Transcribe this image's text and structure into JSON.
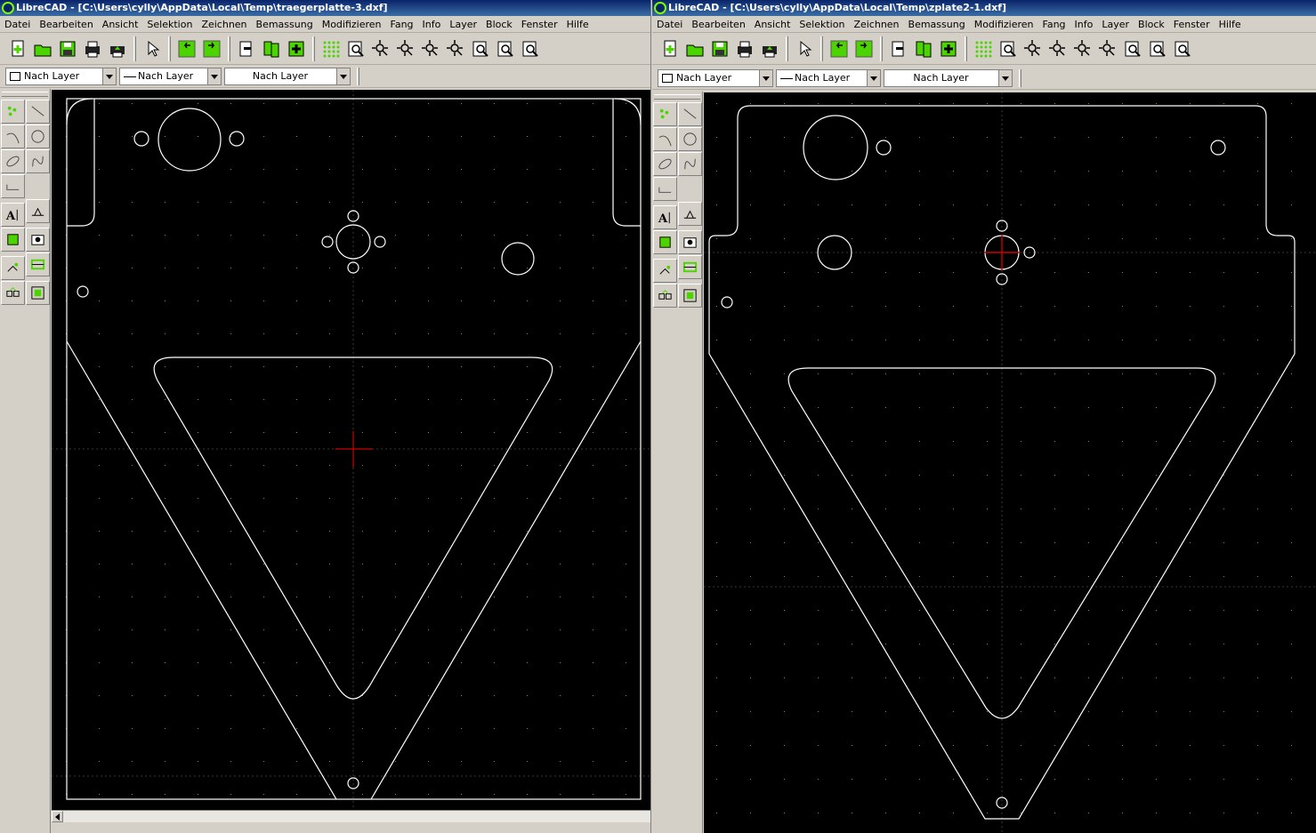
{
  "colors": {
    "title_bg": "#0a246a",
    "chrome": "#d4d0c8",
    "canvas_bg": "#000000",
    "drawing_line": "#ffffff",
    "crosshair": "#d00000",
    "grid_dot": "#808080",
    "icon_green": "#4cd400"
  },
  "windows": [
    {
      "title": "LibreCAD - [C:\\Users\\cylly\\AppData\\Local\\Temp\\traegerplatte-3.dxf]",
      "menu": [
        "Datei",
        "Bearbeiten",
        "Ansicht",
        "Selektion",
        "Zeichnen",
        "Bemassung",
        "Modifizieren",
        "Fang",
        "Info",
        "Layer",
        "Block",
        "Fenster",
        "Hilfe"
      ],
      "combos": {
        "color": "Nach Layer",
        "linetype": "Nach Layer",
        "width": "Nach Layer"
      }
    },
    {
      "title": "LibreCAD - [C:\\Users\\cylly\\AppData\\Local\\Temp\\zplate2-1.dxf]",
      "menu": [
        "Datei",
        "Bearbeiten",
        "Ansicht",
        "Selektion",
        "Zeichnen",
        "Bemassung",
        "Modifizieren",
        "Fang",
        "Info",
        "Layer",
        "Block",
        "Fenster",
        "Hilfe"
      ],
      "combos": {
        "color": "Nach Layer",
        "linetype": "Nach Layer",
        "width": "Nach Layer"
      }
    }
  ],
  "toolbar_icons": [
    "new-file-icon",
    "open-folder-icon",
    "save-icon",
    "print-icon",
    "print-preview-icon",
    "pointer-icon",
    "undo-icon",
    "redo-icon",
    "cut-icon",
    "copy-icon",
    "paste-icon",
    "grid-icon",
    "zoom-window-icon",
    "zoom-pan-icon",
    "zoom-in-icon",
    "zoom-out-icon",
    "zoom-auto-icon",
    "zoom-previous-icon",
    "zoom-redraw-icon",
    "zoom-select-icon"
  ],
  "side_tools": [
    "point-tool-icon",
    "line-tool-icon",
    "arc-tool-icon",
    "circle-tool-icon",
    "ellipse-tool-icon",
    "spline-tool-icon",
    "polyline-tool-icon",
    "",
    "text-tool-icon",
    "dimension-tool-icon",
    "hatch-tool-icon",
    "image-tool-icon",
    "modify-tool-icon",
    "measure-tool-icon",
    "snap-tool-icon",
    "block-tool-icon"
  ]
}
